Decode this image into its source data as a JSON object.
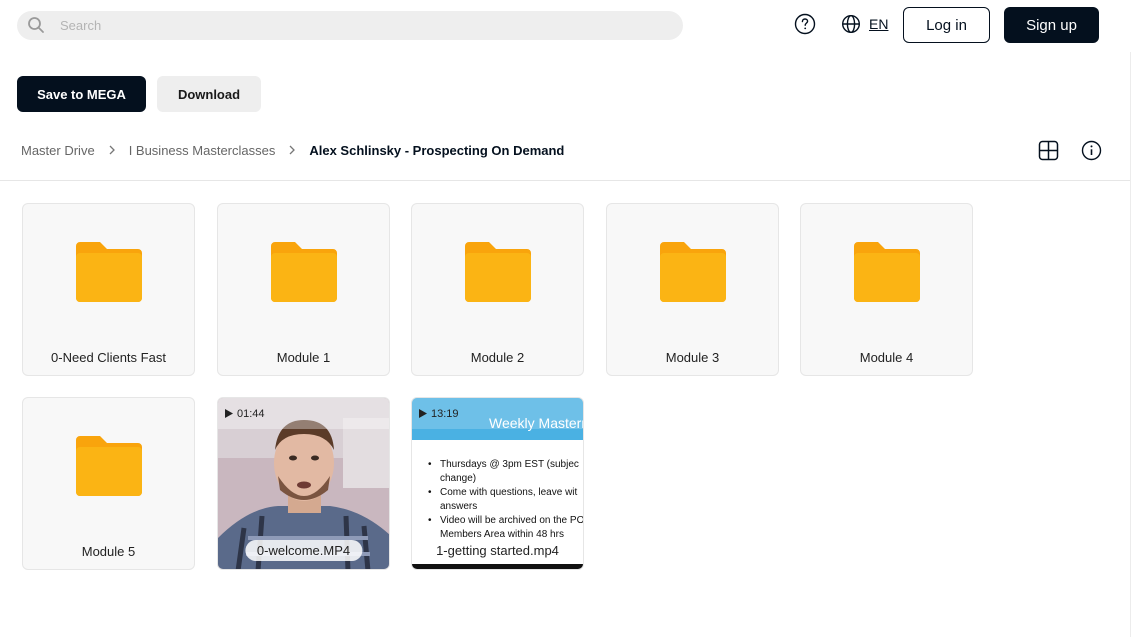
{
  "search": {
    "placeholder": "Search"
  },
  "header": {
    "language": "EN",
    "login_label": "Log in",
    "signup_label": "Sign up"
  },
  "actions": {
    "save_label": "Save to MEGA",
    "download_label": "Download"
  },
  "breadcrumb": {
    "items": [
      "Master Drive",
      "I Business Masterclasses"
    ],
    "current": "Alex Schlinsky - Prospecting On Demand"
  },
  "files": [
    {
      "type": "folder",
      "name": "0-Need Clients Fast"
    },
    {
      "type": "folder",
      "name": "Module 1"
    },
    {
      "type": "folder",
      "name": "Module 2"
    },
    {
      "type": "folder",
      "name": "Module 3"
    },
    {
      "type": "folder",
      "name": "Module 4"
    },
    {
      "type": "folder",
      "name": "Module 5"
    },
    {
      "type": "video",
      "name": "0-welcome.MP4",
      "duration": "01:44"
    },
    {
      "type": "video",
      "name": "1-getting started.mp4",
      "duration": "13:19",
      "thumbnail": {
        "title": "Weekly Masterm",
        "bullets": [
          "Thursdays @ 3pm EST (subjec change)",
          "Come with questions, leave wit answers",
          "Video will be archived on the PO Members Area within 48 hrs"
        ]
      }
    }
  ],
  "colors": {
    "primary": "#04101e",
    "folder": "#fbb414",
    "tile_bg": "#f8f8f8",
    "slide_header": "#4ab1e3"
  }
}
